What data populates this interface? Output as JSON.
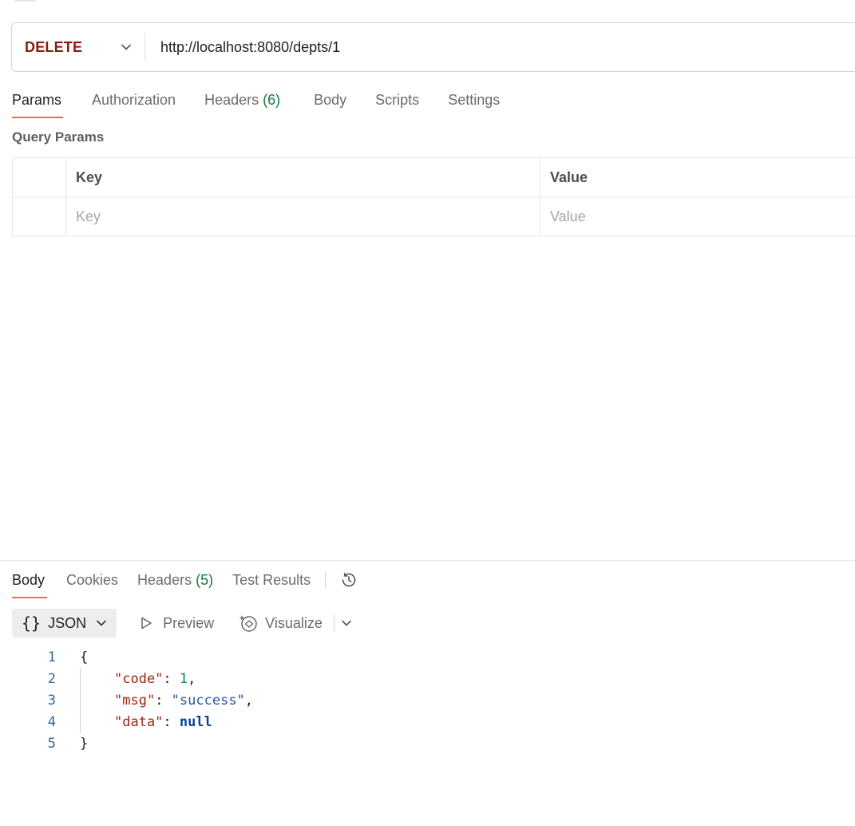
{
  "request": {
    "method": "DELETE",
    "url": "http://localhost:8080/depts/1"
  },
  "request_tabs": [
    {
      "label": "Params",
      "count": ""
    },
    {
      "label": "Authorization",
      "count": ""
    },
    {
      "label": "Headers",
      "count": "(6)"
    },
    {
      "label": "Body",
      "count": ""
    },
    {
      "label": "Scripts",
      "count": ""
    },
    {
      "label": "Settings",
      "count": ""
    }
  ],
  "query_params": {
    "title": "Query Params",
    "columns": {
      "key": "Key",
      "value": "Value"
    },
    "placeholders": {
      "key": "Key",
      "value": "Value"
    }
  },
  "response_tabs": [
    {
      "label": "Body",
      "count": ""
    },
    {
      "label": "Cookies",
      "count": ""
    },
    {
      "label": "Headers",
      "count": "(5)"
    },
    {
      "label": "Test Results",
      "count": ""
    }
  ],
  "response_toolbar": {
    "format_icon": "{}",
    "format_label": "JSON",
    "preview_label": "Preview",
    "visualize_label": "Visualize"
  },
  "response_body": {
    "line_numbers": [
      "1",
      "2",
      "3",
      "4",
      "5"
    ],
    "open_brace": "{",
    "close_brace": "}",
    "colon": ": ",
    "comma": ",",
    "fields": [
      {
        "key": "\"code\"",
        "value": "1"
      },
      {
        "key": "\"msg\"",
        "value": "\"success\""
      },
      {
        "key": "\"data\"",
        "value": "null"
      }
    ]
  },
  "colors": {
    "accent": "#ff6c37",
    "method_delete": "#8a1e0c",
    "count_green": "#0f7b3f",
    "json_key": "#a1260d",
    "json_string": "#2758a8",
    "json_number": "#098658",
    "json_null": "#0b3f9e"
  },
  "icons": [
    "chevron-down-icon",
    "play-outline-icon",
    "visualize-sparkle-icon",
    "history-icon"
  ]
}
